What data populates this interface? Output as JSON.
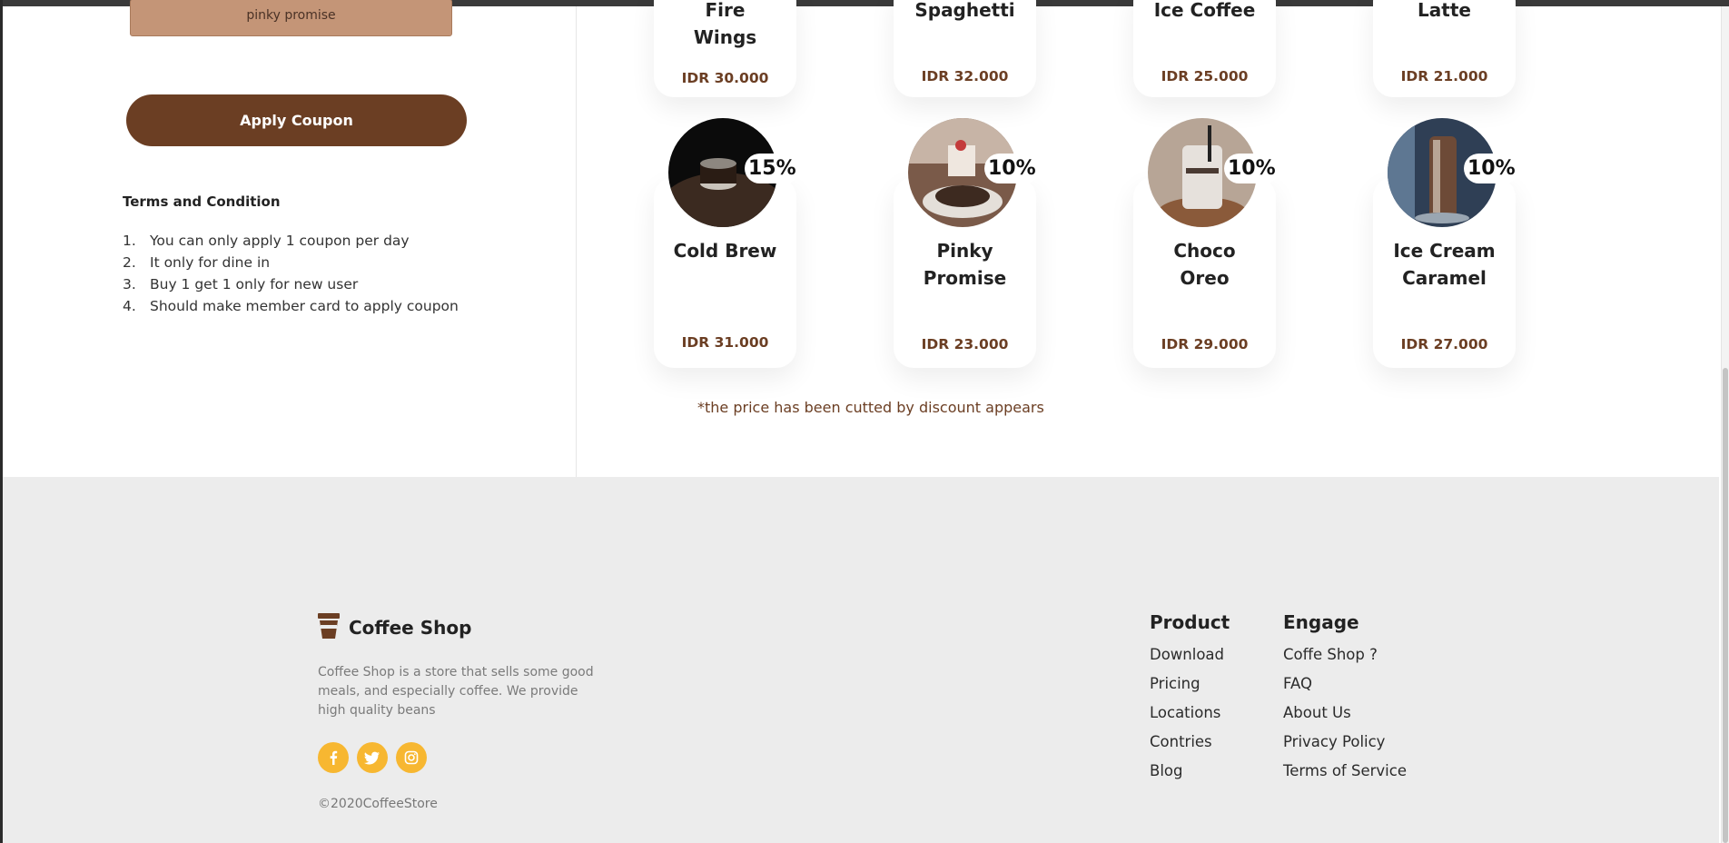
{
  "coupon": {
    "input_value": "pinky promise",
    "apply_label": "Apply Coupon"
  },
  "terms": {
    "title": "Terms and Condition",
    "items": [
      {
        "num": "1.",
        "text": "You can only apply 1 coupon per day"
      },
      {
        "num": "2.",
        "text": "It only for dine in"
      },
      {
        "num": "3.",
        "text": "Buy 1 get 1 only for new user"
      },
      {
        "num": "4.",
        "text": "Should make member card to apply coupon"
      }
    ]
  },
  "products_top": [
    {
      "name_line1": "Fire",
      "name_line2": "Wings",
      "price": "IDR 30.000"
    },
    {
      "name_line1": "Spaghetti",
      "name_line2": "",
      "price": "IDR 32.000"
    },
    {
      "name_line1": "Ice Coffee",
      "name_line2": "",
      "price": "IDR 25.000"
    },
    {
      "name_line1": "Latte",
      "name_line2": "",
      "price": "IDR 21.000"
    }
  ],
  "products_bottom": [
    {
      "name_line1": "Cold Brew",
      "name_line2": "",
      "price": "IDR 31.000",
      "discount": "15%"
    },
    {
      "name_line1": "Pinky",
      "name_line2": "Promise",
      "price": "IDR 23.000",
      "discount": "10%"
    },
    {
      "name_line1": "Choco",
      "name_line2": "Oreo",
      "price": "IDR 29.000",
      "discount": "10%"
    },
    {
      "name_line1": "Ice Cream",
      "name_line2": "Caramel",
      "price": "IDR 27.000",
      "discount": "10%"
    }
  ],
  "note": "*the price has been cutted by discount appears",
  "footer": {
    "brand_name": "Coffee Shop",
    "description": "Coffee Shop is a store that sells some good meals, and especially coffee. We provide high quality beans",
    "socials": [
      "facebook-icon",
      "twitter-icon",
      "instagram-icon"
    ],
    "copyright": "©2020CoffeeStore",
    "product": {
      "title": "Product",
      "links": [
        "Download",
        "Pricing",
        "Locations",
        "Contries",
        "Blog"
      ]
    },
    "engage": {
      "title": "Engage",
      "links": [
        "Coffe Shop ?",
        "FAQ",
        "About Us",
        "Privacy Policy",
        "Terms of Service"
      ]
    }
  },
  "colors": {
    "brand_brown": "#6b3e23",
    "coupon_bg": "#c49577",
    "social_yellow": "#f7b731",
    "footer_bg": "#ececec"
  }
}
